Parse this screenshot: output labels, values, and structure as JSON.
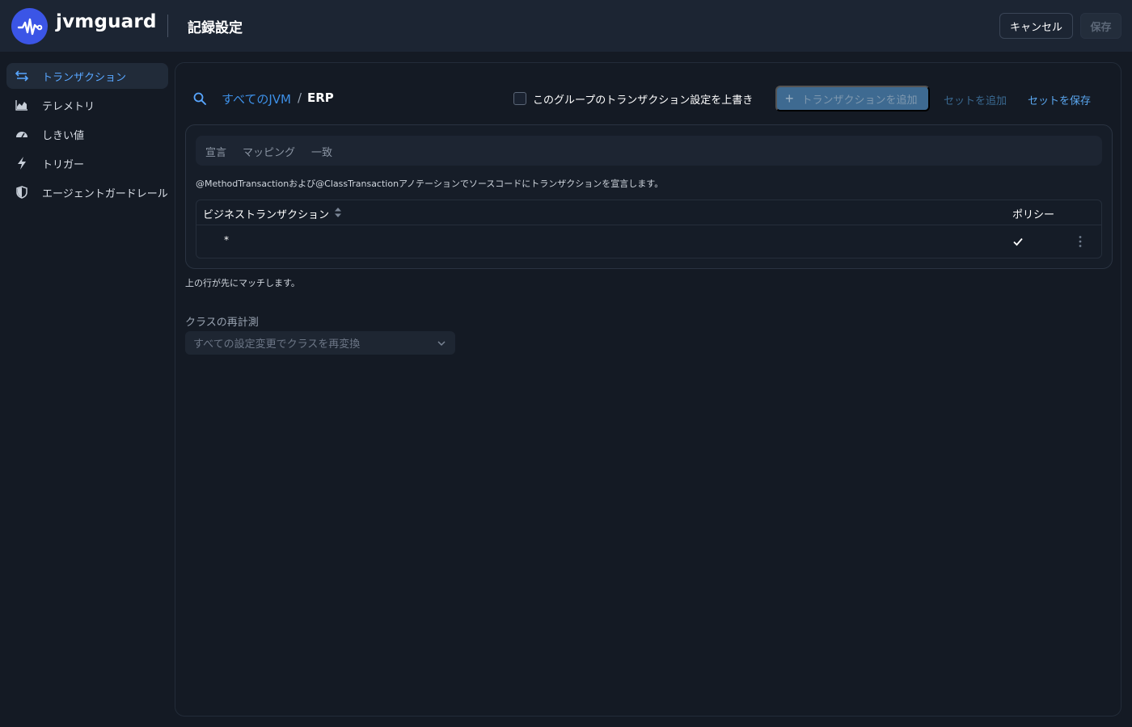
{
  "header": {
    "brand": "jvmguard",
    "title": "記録設定",
    "cancel_label": "キャンセル",
    "save_label": "保存"
  },
  "sidebar": {
    "items": [
      {
        "label": "トランザクション",
        "icon": "transaction-arrows-icon",
        "active": true
      },
      {
        "label": "テレメトリ",
        "icon": "area-chart-icon",
        "active": false
      },
      {
        "label": "しきい値",
        "icon": "gauge-icon",
        "active": false
      },
      {
        "label": "トリガー",
        "icon": "lightning-icon",
        "active": false
      },
      {
        "label": "エージェントガードレール",
        "icon": "shield-icon",
        "active": false
      }
    ]
  },
  "toolbar": {
    "breadcrumb_root": "すべてのJVM",
    "breadcrumb_sep": "/",
    "breadcrumb_current": "ERP",
    "override_label": "このグループのトランザクション設定を上書き",
    "override_checked": false,
    "add_transaction_label": "トランザクションを追加",
    "add_set_label": "セットを追加",
    "save_set_label": "セットを保存"
  },
  "tabs": [
    "宣言",
    "マッピング",
    "一致"
  ],
  "description": "@MethodTransactionおよび@ClassTransactionアノテーションでソースコードにトランザクションを宣言します。",
  "table": {
    "columns": [
      "ビジネストランザクション",
      "ポリシー"
    ],
    "rows": [
      {
        "pattern": "*",
        "policy_checked": true
      }
    ]
  },
  "hint": "上の行が先にマッチします。",
  "retransform": {
    "label": "クラスの再計測",
    "value": "すべての設定変更でクラスを再変換"
  },
  "colors": {
    "accent": "#3b55e6",
    "link": "#3d8fe6",
    "background": "#141a24",
    "header": "#1c2533"
  }
}
